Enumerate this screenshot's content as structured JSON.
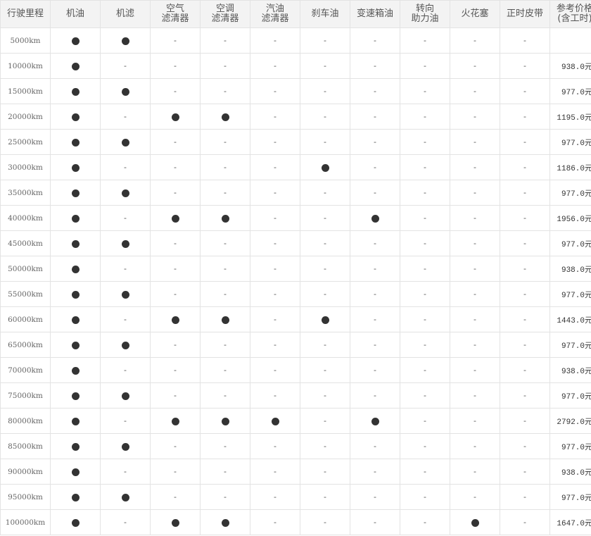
{
  "headers": [
    "行驶里程",
    "机油",
    "机滤",
    "空气\n滤清器",
    "空调\n滤清器",
    "汽油\n滤清器",
    "刹车油",
    "变速箱油",
    "转向\n助力油",
    "火花塞",
    "正时皮带",
    "参考价格\n(含工时)"
  ],
  "symbols": {
    "yes": "●",
    "no": "-",
    "dot_color": "#333333"
  },
  "rows": [
    {
      "mileage": "5000km",
      "items": [
        1,
        1,
        0,
        0,
        0,
        0,
        0,
        0,
        0,
        0
      ],
      "price": ""
    },
    {
      "mileage": "10000km",
      "items": [
        1,
        0,
        0,
        0,
        0,
        0,
        0,
        0,
        0,
        0
      ],
      "price": "938.0元"
    },
    {
      "mileage": "15000km",
      "items": [
        1,
        1,
        0,
        0,
        0,
        0,
        0,
        0,
        0,
        0
      ],
      "price": "977.0元"
    },
    {
      "mileage": "20000km",
      "items": [
        1,
        0,
        1,
        1,
        0,
        0,
        0,
        0,
        0,
        0
      ],
      "price": "1195.0元"
    },
    {
      "mileage": "25000km",
      "items": [
        1,
        1,
        0,
        0,
        0,
        0,
        0,
        0,
        0,
        0
      ],
      "price": "977.0元"
    },
    {
      "mileage": "30000km",
      "items": [
        1,
        0,
        0,
        0,
        0,
        1,
        0,
        0,
        0,
        0
      ],
      "price": "1186.0元"
    },
    {
      "mileage": "35000km",
      "items": [
        1,
        1,
        0,
        0,
        0,
        0,
        0,
        0,
        0,
        0
      ],
      "price": "977.0元"
    },
    {
      "mileage": "40000km",
      "items": [
        1,
        0,
        1,
        1,
        0,
        0,
        1,
        0,
        0,
        0
      ],
      "price": "1956.0元"
    },
    {
      "mileage": "45000km",
      "items": [
        1,
        1,
        0,
        0,
        0,
        0,
        0,
        0,
        0,
        0
      ],
      "price": "977.0元"
    },
    {
      "mileage": "50000km",
      "items": [
        1,
        0,
        0,
        0,
        0,
        0,
        0,
        0,
        0,
        0
      ],
      "price": "938.0元"
    },
    {
      "mileage": "55000km",
      "items": [
        1,
        1,
        0,
        0,
        0,
        0,
        0,
        0,
        0,
        0
      ],
      "price": "977.0元"
    },
    {
      "mileage": "60000km",
      "items": [
        1,
        0,
        1,
        1,
        0,
        1,
        0,
        0,
        0,
        0
      ],
      "price": "1443.0元"
    },
    {
      "mileage": "65000km",
      "items": [
        1,
        1,
        0,
        0,
        0,
        0,
        0,
        0,
        0,
        0
      ],
      "price": "977.0元"
    },
    {
      "mileage": "70000km",
      "items": [
        1,
        0,
        0,
        0,
        0,
        0,
        0,
        0,
        0,
        0
      ],
      "price": "938.0元"
    },
    {
      "mileage": "75000km",
      "items": [
        1,
        1,
        0,
        0,
        0,
        0,
        0,
        0,
        0,
        0
      ],
      "price": "977.0元"
    },
    {
      "mileage": "80000km",
      "items": [
        1,
        0,
        1,
        1,
        1,
        0,
        1,
        0,
        0,
        0
      ],
      "price": "2792.0元"
    },
    {
      "mileage": "85000km",
      "items": [
        1,
        1,
        0,
        0,
        0,
        0,
        0,
        0,
        0,
        0
      ],
      "price": "977.0元"
    },
    {
      "mileage": "90000km",
      "items": [
        1,
        0,
        0,
        0,
        0,
        0,
        0,
        0,
        0,
        0
      ],
      "price": "938.0元"
    },
    {
      "mileage": "95000km",
      "items": [
        1,
        1,
        0,
        0,
        0,
        0,
        0,
        0,
        0,
        0
      ],
      "price": "977.0元"
    },
    {
      "mileage": "100000km",
      "items": [
        1,
        0,
        1,
        1,
        0,
        0,
        0,
        0,
        1,
        0
      ],
      "price": "1647.0元"
    }
  ]
}
